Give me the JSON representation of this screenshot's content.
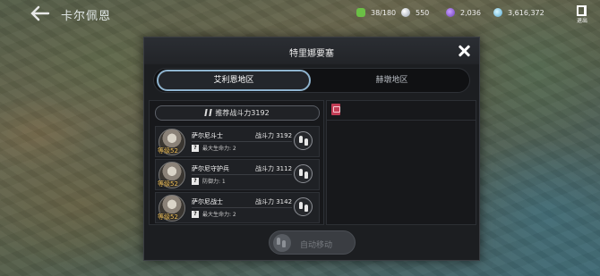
{
  "header": {
    "title": "卡尔佩恩",
    "resources": {
      "stamina": "38/180",
      "silver": "550",
      "gem": "2,036",
      "gold": "3,616,372"
    },
    "exit_label": "退出"
  },
  "modal": {
    "title": "特里娜要塞",
    "tabs": [
      {
        "label": "艾利恩地区",
        "active": true
      },
      {
        "label": "赫墩地区",
        "active": false
      }
    ],
    "recommended": "推荐战斗力3192",
    "enemies": [
      {
        "name": "萨尔尼斗士",
        "level": "等级52",
        "power": "战斗力 3192",
        "stat": "最大生命力: 2"
      },
      {
        "name": "萨尔尼守护兵",
        "level": "等级52",
        "power": "战斗力 3112",
        "stat": "防御力: 1"
      },
      {
        "name": "萨尔尼战士",
        "level": "等级52",
        "power": "战斗力 3142",
        "stat": "最大生命力: 2"
      }
    ],
    "auto_move_label": "自动移动",
    "qmark": "?"
  },
  "colors": {
    "active_tab_border": "#8fb4cf",
    "level_text": "#f0c15a",
    "flag": "#c23d55"
  }
}
